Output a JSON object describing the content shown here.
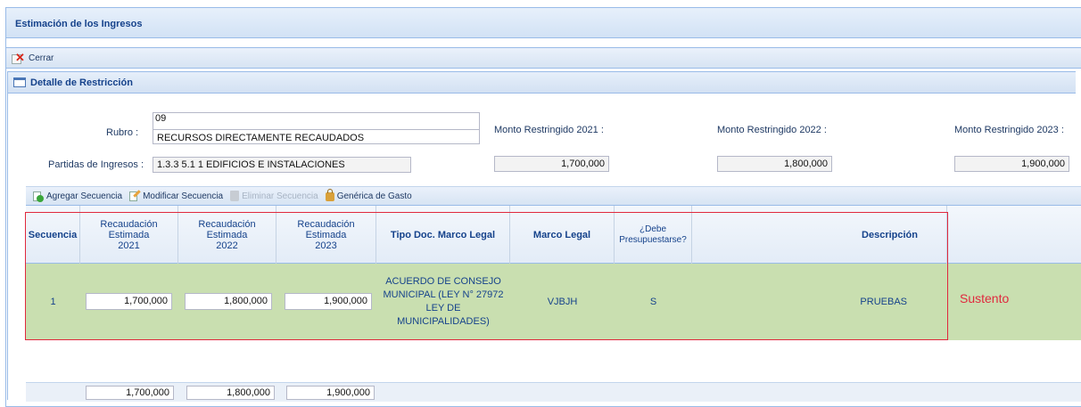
{
  "window": {
    "title": "Estimación de los Ingresos"
  },
  "toolbar": {
    "close_label": "Cerrar"
  },
  "panel": {
    "title": "Detalle de Restricción"
  },
  "form": {
    "rubro_label": "Rubro :",
    "rubro_code": "09",
    "rubro_name": "RECURSOS DIRECTAMENTE RECAUDADOS",
    "partidas_label": "Partidas de Ingresos :",
    "partidas_value": "1.3.3 5.1 1 EDIFICIOS E INSTALACIONES",
    "montos": [
      {
        "label": "Monto Restringido 2021 :",
        "value": "1,700,000"
      },
      {
        "label": "Monto Restringido 2022 :",
        "value": "1,800,000"
      },
      {
        "label": "Monto Restringido 2023 :",
        "value": "1,900,000"
      }
    ]
  },
  "seq_toolbar": {
    "add": "Agregar Secuencia",
    "modify": "Modificar Secuencia",
    "delete": "Eliminar Secuencia",
    "generic": "Genérica de Gasto"
  },
  "grid": {
    "headers": {
      "secuencia": "Secuencia",
      "rec2021": "Recaudación Estimada 2021",
      "rec2022": "Recaudación Estimada 2022",
      "rec2023": "Recaudación Estimada 2023",
      "tipo_doc": "Tipo Doc. Marco Legal",
      "marco": "Marco Legal",
      "debe": "¿Debe Presupuestarse?",
      "descripcion": "Descripción"
    },
    "row": {
      "secuencia": "1",
      "rec2021": "1,700,000",
      "rec2022": "1,800,000",
      "rec2023": "1,900,000",
      "tipo_doc": "ACUERDO DE CONSEJO MUNICIPAL (LEY N° 27972 LEY DE MUNICIPALIDADES)",
      "marco": "VJBJH",
      "debe": "S",
      "descripcion": "PRUEBAS"
    },
    "totals": {
      "rec2021": "1,700,000",
      "rec2022": "1,800,000",
      "rec2023": "1,900,000"
    }
  },
  "annotation": {
    "text": "Sustento",
    "color": "#e0293e"
  }
}
